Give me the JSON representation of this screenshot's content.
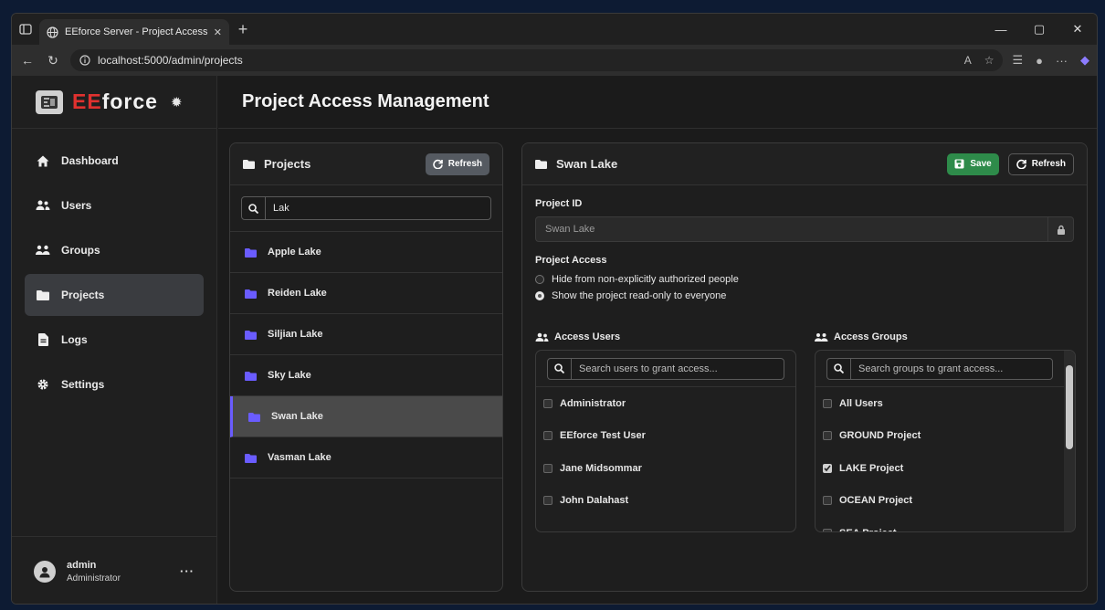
{
  "browser": {
    "tab_title": "EEforce Server - Project Access M",
    "url": "localhost:5000/admin/projects"
  },
  "sidebar": {
    "brand_ee": "EE",
    "brand_rest": "force",
    "items": [
      {
        "label": "Dashboard",
        "icon": "home-icon"
      },
      {
        "label": "Users",
        "icon": "users-icon"
      },
      {
        "label": "Groups",
        "icon": "groups-icon"
      },
      {
        "label": "Projects",
        "icon": "folder-icon",
        "active": true
      },
      {
        "label": "Logs",
        "icon": "file-icon"
      },
      {
        "label": "Settings",
        "icon": "gear-icon"
      }
    ],
    "user": {
      "name": "admin",
      "role": "Administrator"
    }
  },
  "header": {
    "title": "Project Access Management"
  },
  "projects": {
    "title": "Projects",
    "refresh_label": "Refresh",
    "search_value": "Lak",
    "items": [
      "Apple Lake",
      "Reiden Lake",
      "Siljian Lake",
      "Sky Lake",
      "Swan Lake",
      "Vasman Lake"
    ],
    "selected": "Swan Lake"
  },
  "detail": {
    "title": "Swan Lake",
    "save_label": "Save",
    "refresh_label": "Refresh",
    "project_id_label": "Project ID",
    "project_id_value": "Swan Lake",
    "access_label": "Project Access",
    "access_options": [
      {
        "label": "Hide from non-explicitly authorized people",
        "checked": false
      },
      {
        "label": "Show the project read-only to everyone",
        "checked": true
      }
    ],
    "users": {
      "title": "Access Users",
      "placeholder": "Search users to grant access...",
      "items": [
        {
          "label": "Administrator",
          "checked": false
        },
        {
          "label": "EEforce Test User",
          "checked": false
        },
        {
          "label": "Jane Midsommar",
          "checked": false
        },
        {
          "label": "John Dalahast",
          "checked": false
        }
      ]
    },
    "groups": {
      "title": "Access Groups",
      "placeholder": "Search groups to grant access...",
      "items": [
        {
          "label": "All Users",
          "checked": false
        },
        {
          "label": "GROUND Project",
          "checked": false
        },
        {
          "label": "LAKE Project",
          "checked": true
        },
        {
          "label": "OCEAN Project",
          "checked": false
        },
        {
          "label": "SEA Project",
          "checked": false
        }
      ]
    }
  },
  "colors": {
    "accent": "#6a5cff",
    "save_green": "#2e8b4a",
    "brand_red": "#e0312f"
  }
}
